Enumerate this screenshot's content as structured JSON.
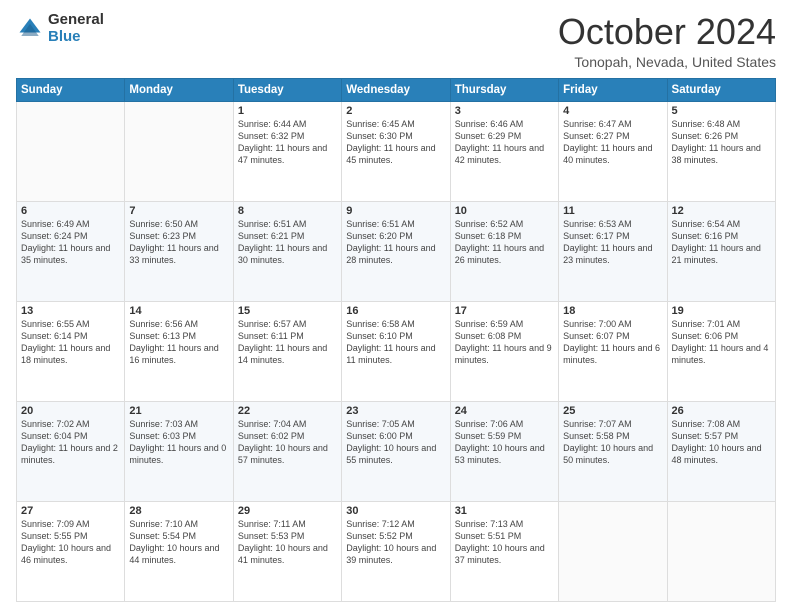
{
  "header": {
    "logo_general": "General",
    "logo_blue": "Blue",
    "title": "October 2024",
    "location": "Tonopah, Nevada, United States"
  },
  "days_of_week": [
    "Sunday",
    "Monday",
    "Tuesday",
    "Wednesday",
    "Thursday",
    "Friday",
    "Saturday"
  ],
  "weeks": [
    [
      {
        "day": "",
        "info": ""
      },
      {
        "day": "",
        "info": ""
      },
      {
        "day": "1",
        "info": "Sunrise: 6:44 AM\nSunset: 6:32 PM\nDaylight: 11 hours and 47 minutes."
      },
      {
        "day": "2",
        "info": "Sunrise: 6:45 AM\nSunset: 6:30 PM\nDaylight: 11 hours and 45 minutes."
      },
      {
        "day": "3",
        "info": "Sunrise: 6:46 AM\nSunset: 6:29 PM\nDaylight: 11 hours and 42 minutes."
      },
      {
        "day": "4",
        "info": "Sunrise: 6:47 AM\nSunset: 6:27 PM\nDaylight: 11 hours and 40 minutes."
      },
      {
        "day": "5",
        "info": "Sunrise: 6:48 AM\nSunset: 6:26 PM\nDaylight: 11 hours and 38 minutes."
      }
    ],
    [
      {
        "day": "6",
        "info": "Sunrise: 6:49 AM\nSunset: 6:24 PM\nDaylight: 11 hours and 35 minutes."
      },
      {
        "day": "7",
        "info": "Sunrise: 6:50 AM\nSunset: 6:23 PM\nDaylight: 11 hours and 33 minutes."
      },
      {
        "day": "8",
        "info": "Sunrise: 6:51 AM\nSunset: 6:21 PM\nDaylight: 11 hours and 30 minutes."
      },
      {
        "day": "9",
        "info": "Sunrise: 6:51 AM\nSunset: 6:20 PM\nDaylight: 11 hours and 28 minutes."
      },
      {
        "day": "10",
        "info": "Sunrise: 6:52 AM\nSunset: 6:18 PM\nDaylight: 11 hours and 26 minutes."
      },
      {
        "day": "11",
        "info": "Sunrise: 6:53 AM\nSunset: 6:17 PM\nDaylight: 11 hours and 23 minutes."
      },
      {
        "day": "12",
        "info": "Sunrise: 6:54 AM\nSunset: 6:16 PM\nDaylight: 11 hours and 21 minutes."
      }
    ],
    [
      {
        "day": "13",
        "info": "Sunrise: 6:55 AM\nSunset: 6:14 PM\nDaylight: 11 hours and 18 minutes."
      },
      {
        "day": "14",
        "info": "Sunrise: 6:56 AM\nSunset: 6:13 PM\nDaylight: 11 hours and 16 minutes."
      },
      {
        "day": "15",
        "info": "Sunrise: 6:57 AM\nSunset: 6:11 PM\nDaylight: 11 hours and 14 minutes."
      },
      {
        "day": "16",
        "info": "Sunrise: 6:58 AM\nSunset: 6:10 PM\nDaylight: 11 hours and 11 minutes."
      },
      {
        "day": "17",
        "info": "Sunrise: 6:59 AM\nSunset: 6:08 PM\nDaylight: 11 hours and 9 minutes."
      },
      {
        "day": "18",
        "info": "Sunrise: 7:00 AM\nSunset: 6:07 PM\nDaylight: 11 hours and 6 minutes."
      },
      {
        "day": "19",
        "info": "Sunrise: 7:01 AM\nSunset: 6:06 PM\nDaylight: 11 hours and 4 minutes."
      }
    ],
    [
      {
        "day": "20",
        "info": "Sunrise: 7:02 AM\nSunset: 6:04 PM\nDaylight: 11 hours and 2 minutes."
      },
      {
        "day": "21",
        "info": "Sunrise: 7:03 AM\nSunset: 6:03 PM\nDaylight: 11 hours and 0 minutes."
      },
      {
        "day": "22",
        "info": "Sunrise: 7:04 AM\nSunset: 6:02 PM\nDaylight: 10 hours and 57 minutes."
      },
      {
        "day": "23",
        "info": "Sunrise: 7:05 AM\nSunset: 6:00 PM\nDaylight: 10 hours and 55 minutes."
      },
      {
        "day": "24",
        "info": "Sunrise: 7:06 AM\nSunset: 5:59 PM\nDaylight: 10 hours and 53 minutes."
      },
      {
        "day": "25",
        "info": "Sunrise: 7:07 AM\nSunset: 5:58 PM\nDaylight: 10 hours and 50 minutes."
      },
      {
        "day": "26",
        "info": "Sunrise: 7:08 AM\nSunset: 5:57 PM\nDaylight: 10 hours and 48 minutes."
      }
    ],
    [
      {
        "day": "27",
        "info": "Sunrise: 7:09 AM\nSunset: 5:55 PM\nDaylight: 10 hours and 46 minutes."
      },
      {
        "day": "28",
        "info": "Sunrise: 7:10 AM\nSunset: 5:54 PM\nDaylight: 10 hours and 44 minutes."
      },
      {
        "day": "29",
        "info": "Sunrise: 7:11 AM\nSunset: 5:53 PM\nDaylight: 10 hours and 41 minutes."
      },
      {
        "day": "30",
        "info": "Sunrise: 7:12 AM\nSunset: 5:52 PM\nDaylight: 10 hours and 39 minutes."
      },
      {
        "day": "31",
        "info": "Sunrise: 7:13 AM\nSunset: 5:51 PM\nDaylight: 10 hours and 37 minutes."
      },
      {
        "day": "",
        "info": ""
      },
      {
        "day": "",
        "info": ""
      }
    ]
  ]
}
